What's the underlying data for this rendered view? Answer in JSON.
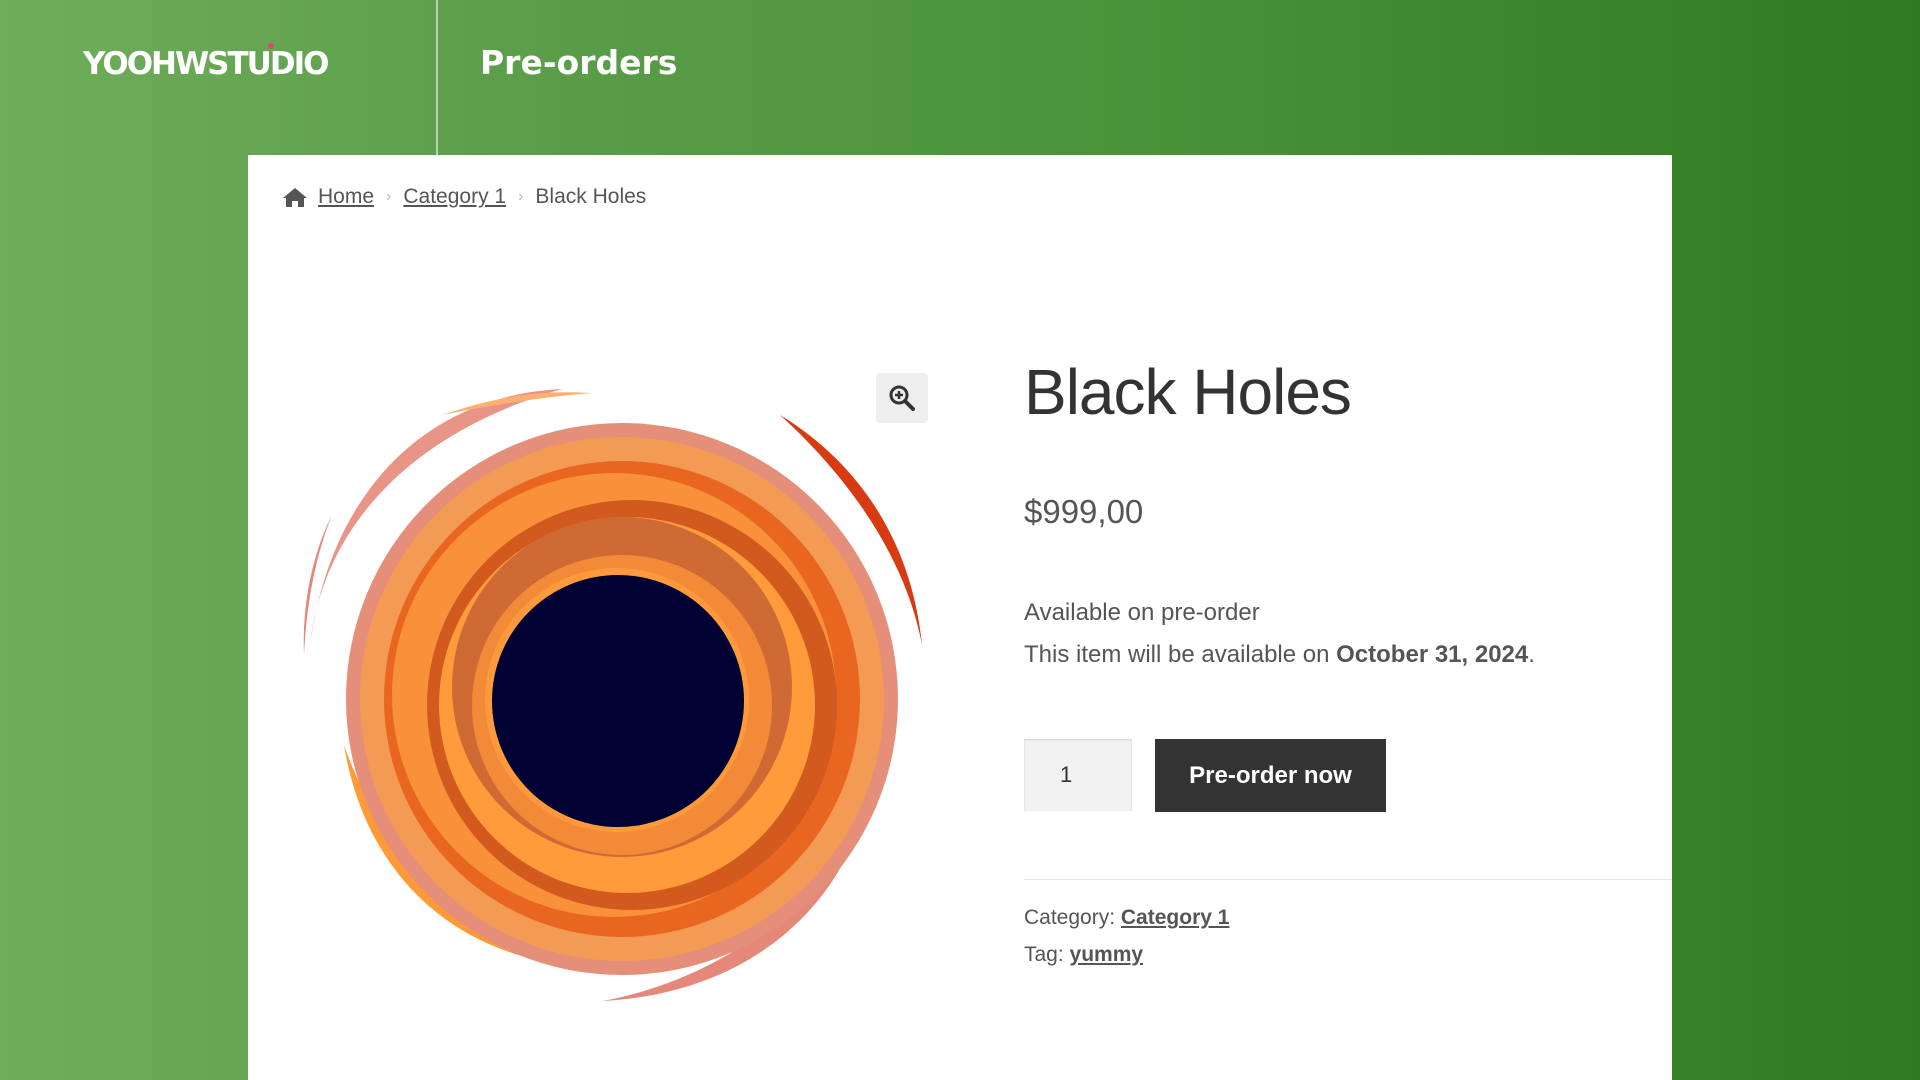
{
  "header": {
    "logo_text": "YOOHWSTUDIO",
    "title": "Pre-orders"
  },
  "breadcrumb": {
    "home": "Home",
    "category": "Category 1",
    "current": "Black Holes"
  },
  "product": {
    "title": "Black Holes",
    "price": "$999,00",
    "availability_title": "Available on pre-order",
    "availability_text": "This item will be available on ",
    "availability_date": "October 31, 2024",
    "availability_end": ".",
    "quantity": "1",
    "button_label": "Pre-order now",
    "category_label": "Category: ",
    "category_value": "Category 1",
    "tag_label": "Tag: ",
    "tag_value": "yummy"
  },
  "icons": {
    "home": "home-icon",
    "zoom": "zoom-in-icon",
    "separator": "chevron-right-icon"
  },
  "colors": {
    "button_bg": "#333333",
    "header_gradient_start": "#6fae5a",
    "header_gradient_end": "#2f7a20",
    "hole_center": "#000033"
  }
}
